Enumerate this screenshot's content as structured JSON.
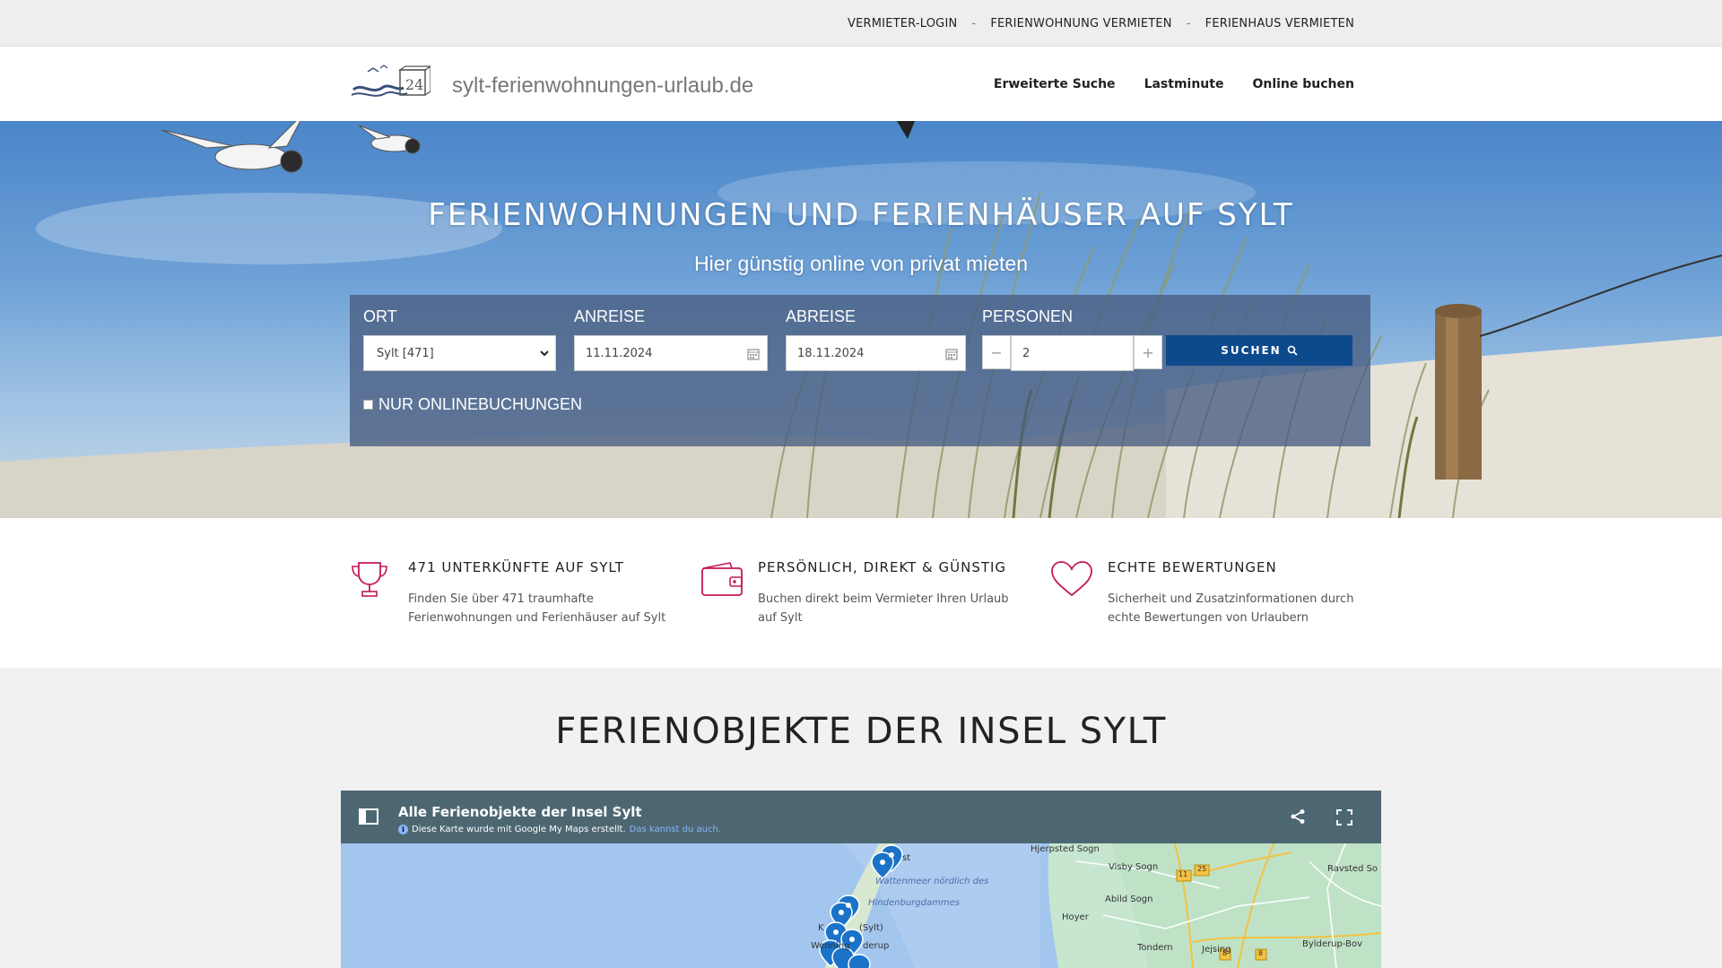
{
  "topbar": {
    "links": [
      "VERMIETER-LOGIN",
      "FERIENWOHNUNG VERMIETEN",
      "FERIENHAUS VERMIETEN"
    ],
    "separator": "-"
  },
  "header": {
    "site_name": "sylt-ferienwohnungen-urlaub.de",
    "nav": [
      "Erweiterte Suche",
      "Lastminute",
      "Online buchen"
    ]
  },
  "hero": {
    "title": "FERIENWOHNUNGEN UND FERIENHÄUSER AUF SYLT",
    "subtitle": "Hier günstig online von privat mieten"
  },
  "search": {
    "ort_label": "ORT",
    "ort_value": "Sylt [471]",
    "anreise_label": "ANREISE",
    "anreise_value": "11.11.2024",
    "abreise_label": "ABREISE",
    "abreise_value": "18.11.2024",
    "personen_label": "PERSONEN",
    "personen_value": "2",
    "minus": "−",
    "plus": "+",
    "button_label": "SUCHEN",
    "online_only_label": "NUR ONLINEBUCHUNGEN"
  },
  "features": [
    {
      "icon": "trophy-icon",
      "title": "471 UNTERKÜNFTE AUF SYLT",
      "text": "Finden Sie über 471 traumhafte Ferienwohnungen und Ferienhäuser auf Sylt"
    },
    {
      "icon": "wallet-icon",
      "title": "PERSÖNLICH, DIREKT & GÜNSTIG",
      "text": "Buchen direkt beim Vermieter Ihren Urlaub auf Sylt"
    },
    {
      "icon": "heart-icon",
      "title": "ECHTE BEWERTUNGEN",
      "text": "Sicherheit und Zusatzinformationen durch echte Bewertungen von Urlaubern"
    }
  ],
  "objects": {
    "title": "FERIENOBJEKTE DER INSEL SYLT"
  },
  "map": {
    "title": "Alle Ferienobjekte der Insel Sylt",
    "star": "☆",
    "info_text": "Diese Karte wurde mit Google My Maps erstellt.",
    "info_link": "Das kannst du auch.",
    "labels": [
      "Hjerpsted Sogn",
      "Visby Sogn",
      "Ravsted So",
      "Wattenmeer nördlich des",
      "Hindenburgdammes",
      "Abild Sogn",
      "Hoyer",
      "Tondern",
      "Jejsing",
      "Bylderup-Bov",
      "Wenning",
      "(Sylt)",
      "derup",
      "st",
      "K"
    ],
    "road_numbers": [
      "11",
      "25",
      "8",
      "8"
    ]
  },
  "colors": {
    "accent_icon": "#c2185b",
    "search_button": "#0d4a8c",
    "map_header": "#4d6772"
  }
}
